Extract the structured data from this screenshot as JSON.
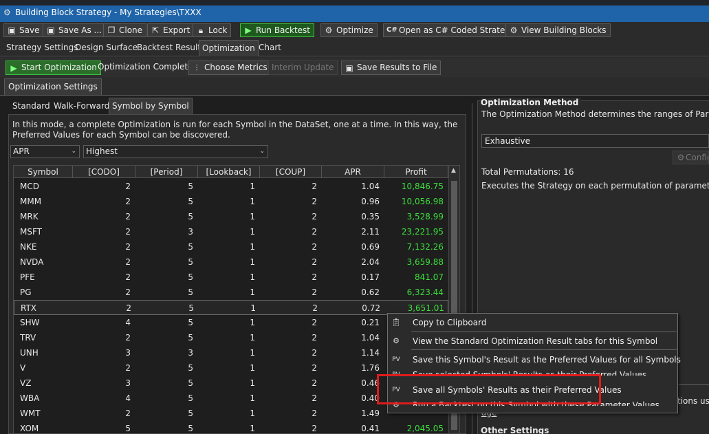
{
  "window": {
    "title": "Building Block Strategy - My Strategies\\TXXX"
  },
  "toolbar": {
    "save": "Save",
    "save_as": "Save As ...",
    "clone": "Clone",
    "export": "Export",
    "lock": "Lock",
    "run_backtest": "Run Backtest",
    "optimize": "Optimize",
    "open_csharp": "Open as C# Coded Strategy",
    "view_blocks": "View Building Blocks"
  },
  "main_tabs": {
    "strategy_settings": "Strategy Settings",
    "design_surface": "Design Surface",
    "backtest_results": "Backtest Results",
    "optimization": "Optimization",
    "chart": "Chart"
  },
  "action_bar": {
    "start_optimization": "Start Optimization",
    "status": "Optimization Complete",
    "choose_metrics": "Choose Metrics",
    "interim_update": "Interim Update",
    "save_results": "Save Results to File"
  },
  "settings_tab": "Optimization Settings",
  "mode_tabs": {
    "standard": "Standard",
    "walk_forward": "Walk-Forward",
    "symbol_by_symbol": "Symbol by Symbol"
  },
  "description": "In this mode, a complete Optimization is run for each Symbol in the DataSet, one at a time. In this way, the Preferred Values for each Symbol can be discovered.",
  "metric_select": "APR",
  "direction_select": "Highest",
  "table": {
    "headers": [
      "Symbol",
      "[CODO]",
      "[Period]",
      "[Lookback]",
      "[COUP]",
      "APR",
      "Profit"
    ],
    "rows": [
      [
        "MCD",
        "2",
        "5",
        "1",
        "2",
        "1.04",
        "10,846.75"
      ],
      [
        "MMM",
        "2",
        "5",
        "1",
        "2",
        "0.96",
        "10,056.98"
      ],
      [
        "MRK",
        "2",
        "5",
        "1",
        "2",
        "0.35",
        "3,528.99"
      ],
      [
        "MSFT",
        "2",
        "3",
        "1",
        "2",
        "2.11",
        "23,221.95"
      ],
      [
        "NKE",
        "2",
        "5",
        "1",
        "2",
        "0.69",
        "7,132.26"
      ],
      [
        "NVDA",
        "2",
        "5",
        "1",
        "2",
        "2.04",
        "3,659.88"
      ],
      [
        "PFE",
        "2",
        "5",
        "1",
        "2",
        "0.17",
        "841.07"
      ],
      [
        "PG",
        "2",
        "5",
        "1",
        "2",
        "0.62",
        "6,323.44"
      ],
      [
        "RTX",
        "2",
        "5",
        "1",
        "2",
        "0.72",
        "3,651.01"
      ],
      [
        "SHW",
        "4",
        "5",
        "1",
        "2",
        "0.21",
        ""
      ],
      [
        "TRV",
        "2",
        "5",
        "1",
        "2",
        "1.04",
        ""
      ],
      [
        "UNH",
        "3",
        "3",
        "1",
        "2",
        "1.14",
        ""
      ],
      [
        "V",
        "2",
        "5",
        "1",
        "2",
        "1.76",
        ""
      ],
      [
        "VZ",
        "3",
        "5",
        "1",
        "2",
        "0.46",
        ""
      ],
      [
        "WBA",
        "4",
        "5",
        "1",
        "2",
        "0.40",
        ""
      ],
      [
        "WMT",
        "2",
        "5",
        "1",
        "2",
        "1.49",
        ""
      ],
      [
        "XOM",
        "5",
        "5",
        "1",
        "2",
        "0.41",
        "2,045.05"
      ]
    ],
    "selected_row": 8
  },
  "right_panel": {
    "title": "Optimization Method",
    "description": "The Optimization Method determines the ranges of Parameter during the optimization.",
    "method": "Exhaustive",
    "config": "Config",
    "permutations": "Total Permutations: 16",
    "executes": "Executes the Strategy on each permutation of parameter values",
    "fragment_1": "tions usin",
    "fragment_2": "age",
    "other_settings": "Other Settings"
  },
  "context_menu": {
    "items": [
      {
        "icon": "clipboard-icon",
        "label": "Copy to Clipboard"
      },
      {
        "icon": "gears-icon",
        "label": "View the Standard Optimization Result tabs for this Symbol"
      },
      {
        "icon": "pv-icon",
        "label": "Save this Symbol's Result as the Preferred Values for all Symbols"
      },
      {
        "icon": "pv-icon",
        "label": "Save selected Symbols' Results as their Preferred Values"
      },
      {
        "icon": "pv-icon",
        "label": "Save all Symbols' Results as their Preferred Values"
      },
      {
        "icon": "run-icon",
        "label": "Run a Backtest on this Symbol with these Parameter Values"
      }
    ]
  },
  "colors": {
    "accent": "#1f64a8",
    "profit": "#3dde3d",
    "highlight": "#e01b1b"
  }
}
